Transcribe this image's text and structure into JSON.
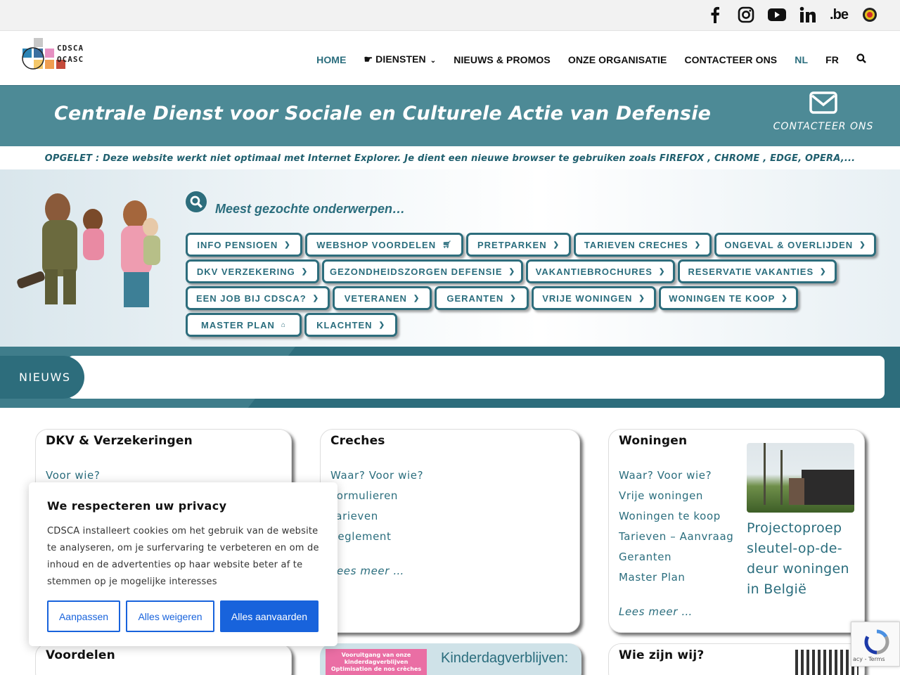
{
  "social": {
    "icons": [
      "facebook-icon",
      "instagram-icon",
      "youtube-icon",
      "linkedin-icon",
      "belgium-be-icon",
      "defence-roundel-icon"
    ],
    "be_text": ".be"
  },
  "logo": {
    "line1": "CDSCA",
    "line2": "OCASC"
  },
  "nav": {
    "home": "HOME",
    "diensten": "DIENSTEN",
    "nieuws": "NIEUWS & PROMOS",
    "organisatie": "ONZE ORGANISATIE",
    "contact": "CONTACTEER ONS",
    "nl": "NL",
    "fr": "FR"
  },
  "banner": {
    "title": "Centrale Dienst voor Sociale en Culturele Actie van Defensie",
    "contact_label": "CONTACTEER ONS"
  },
  "notice": "OPGELET : Deze website werkt niet optimaal met Internet Explorer. Je dient een nieuwe browser te gebruiken zoals FIREFOX , CHROME , EDGE, OPERA,...",
  "search": {
    "label": "Meest gezochte onderwerpen…",
    "rows": [
      [
        "INFO PENSIOEN",
        "WEBSHOP VOORDELEN",
        "PRETPARKEN",
        "TARIEVEN CRECHES",
        "ONGEVAL & OVERLIJDEN"
      ],
      [
        "DKV VERZEKERING",
        "GEZONDHEIDSZORGEN DEFENSIE",
        "VAKANTIEBROCHURES",
        "RESERVATIE VAKANTIES"
      ],
      [
        "EEN JOB BIJ CDSCA?",
        "VETERANEN",
        "GERANTEN",
        "VRIJE WONINGEN",
        "WONINGEN TE KOOP"
      ],
      [
        "MASTER PLAN",
        "KLACHTEN"
      ]
    ]
  },
  "news": {
    "label": "NIEUWS"
  },
  "cards": {
    "dkv": {
      "title": "DKV & Verzekeringen",
      "links": [
        "Voor wie?"
      ]
    },
    "creches": {
      "title": "Creches",
      "links": [
        "Waar? Voor wie?",
        "Formulieren",
        "Tarieven",
        "Reglement"
      ],
      "more": "Lees meer …"
    },
    "woningen": {
      "title": "Woningen",
      "links": [
        "Waar? Voor wie?",
        "Vrije woningen",
        "Woningen te koop",
        "Tarieven – Aanvraag",
        "Geranten",
        "Master Plan"
      ],
      "more": "Lees meer …",
      "project": "Projectoproep sleutel-op-de-deur woningen in België"
    },
    "voordelen": {
      "title": "Voordelen"
    },
    "kinder": {
      "thumb_line1": "Vooruitgang van onze",
      "thumb_line2": "kinderdagverblijven",
      "thumb_line3": "Optimisation de nos crèches",
      "title": "Kinderdagverblijven:"
    },
    "wie": {
      "title": "Wie zijn wij?"
    }
  },
  "cookie": {
    "title": "We respecteren uw privacy",
    "text": "CDSCA installeert cookies om het gebruik van de website te analyseren, om je surfervaring te verbeteren en om de inhoud en de advertenties op haar website beter af te stemmen op je mogelijke interesses",
    "btn_customize": "Aanpassen",
    "btn_reject": "Alles weigeren",
    "btn_accept": "Alles aanvaarden"
  },
  "recaptcha": {
    "text": "acy - Terms"
  },
  "colors": {
    "brand": "#2d6d7c",
    "banner": "#4d8a96",
    "cookie_button": "#1863dc"
  }
}
